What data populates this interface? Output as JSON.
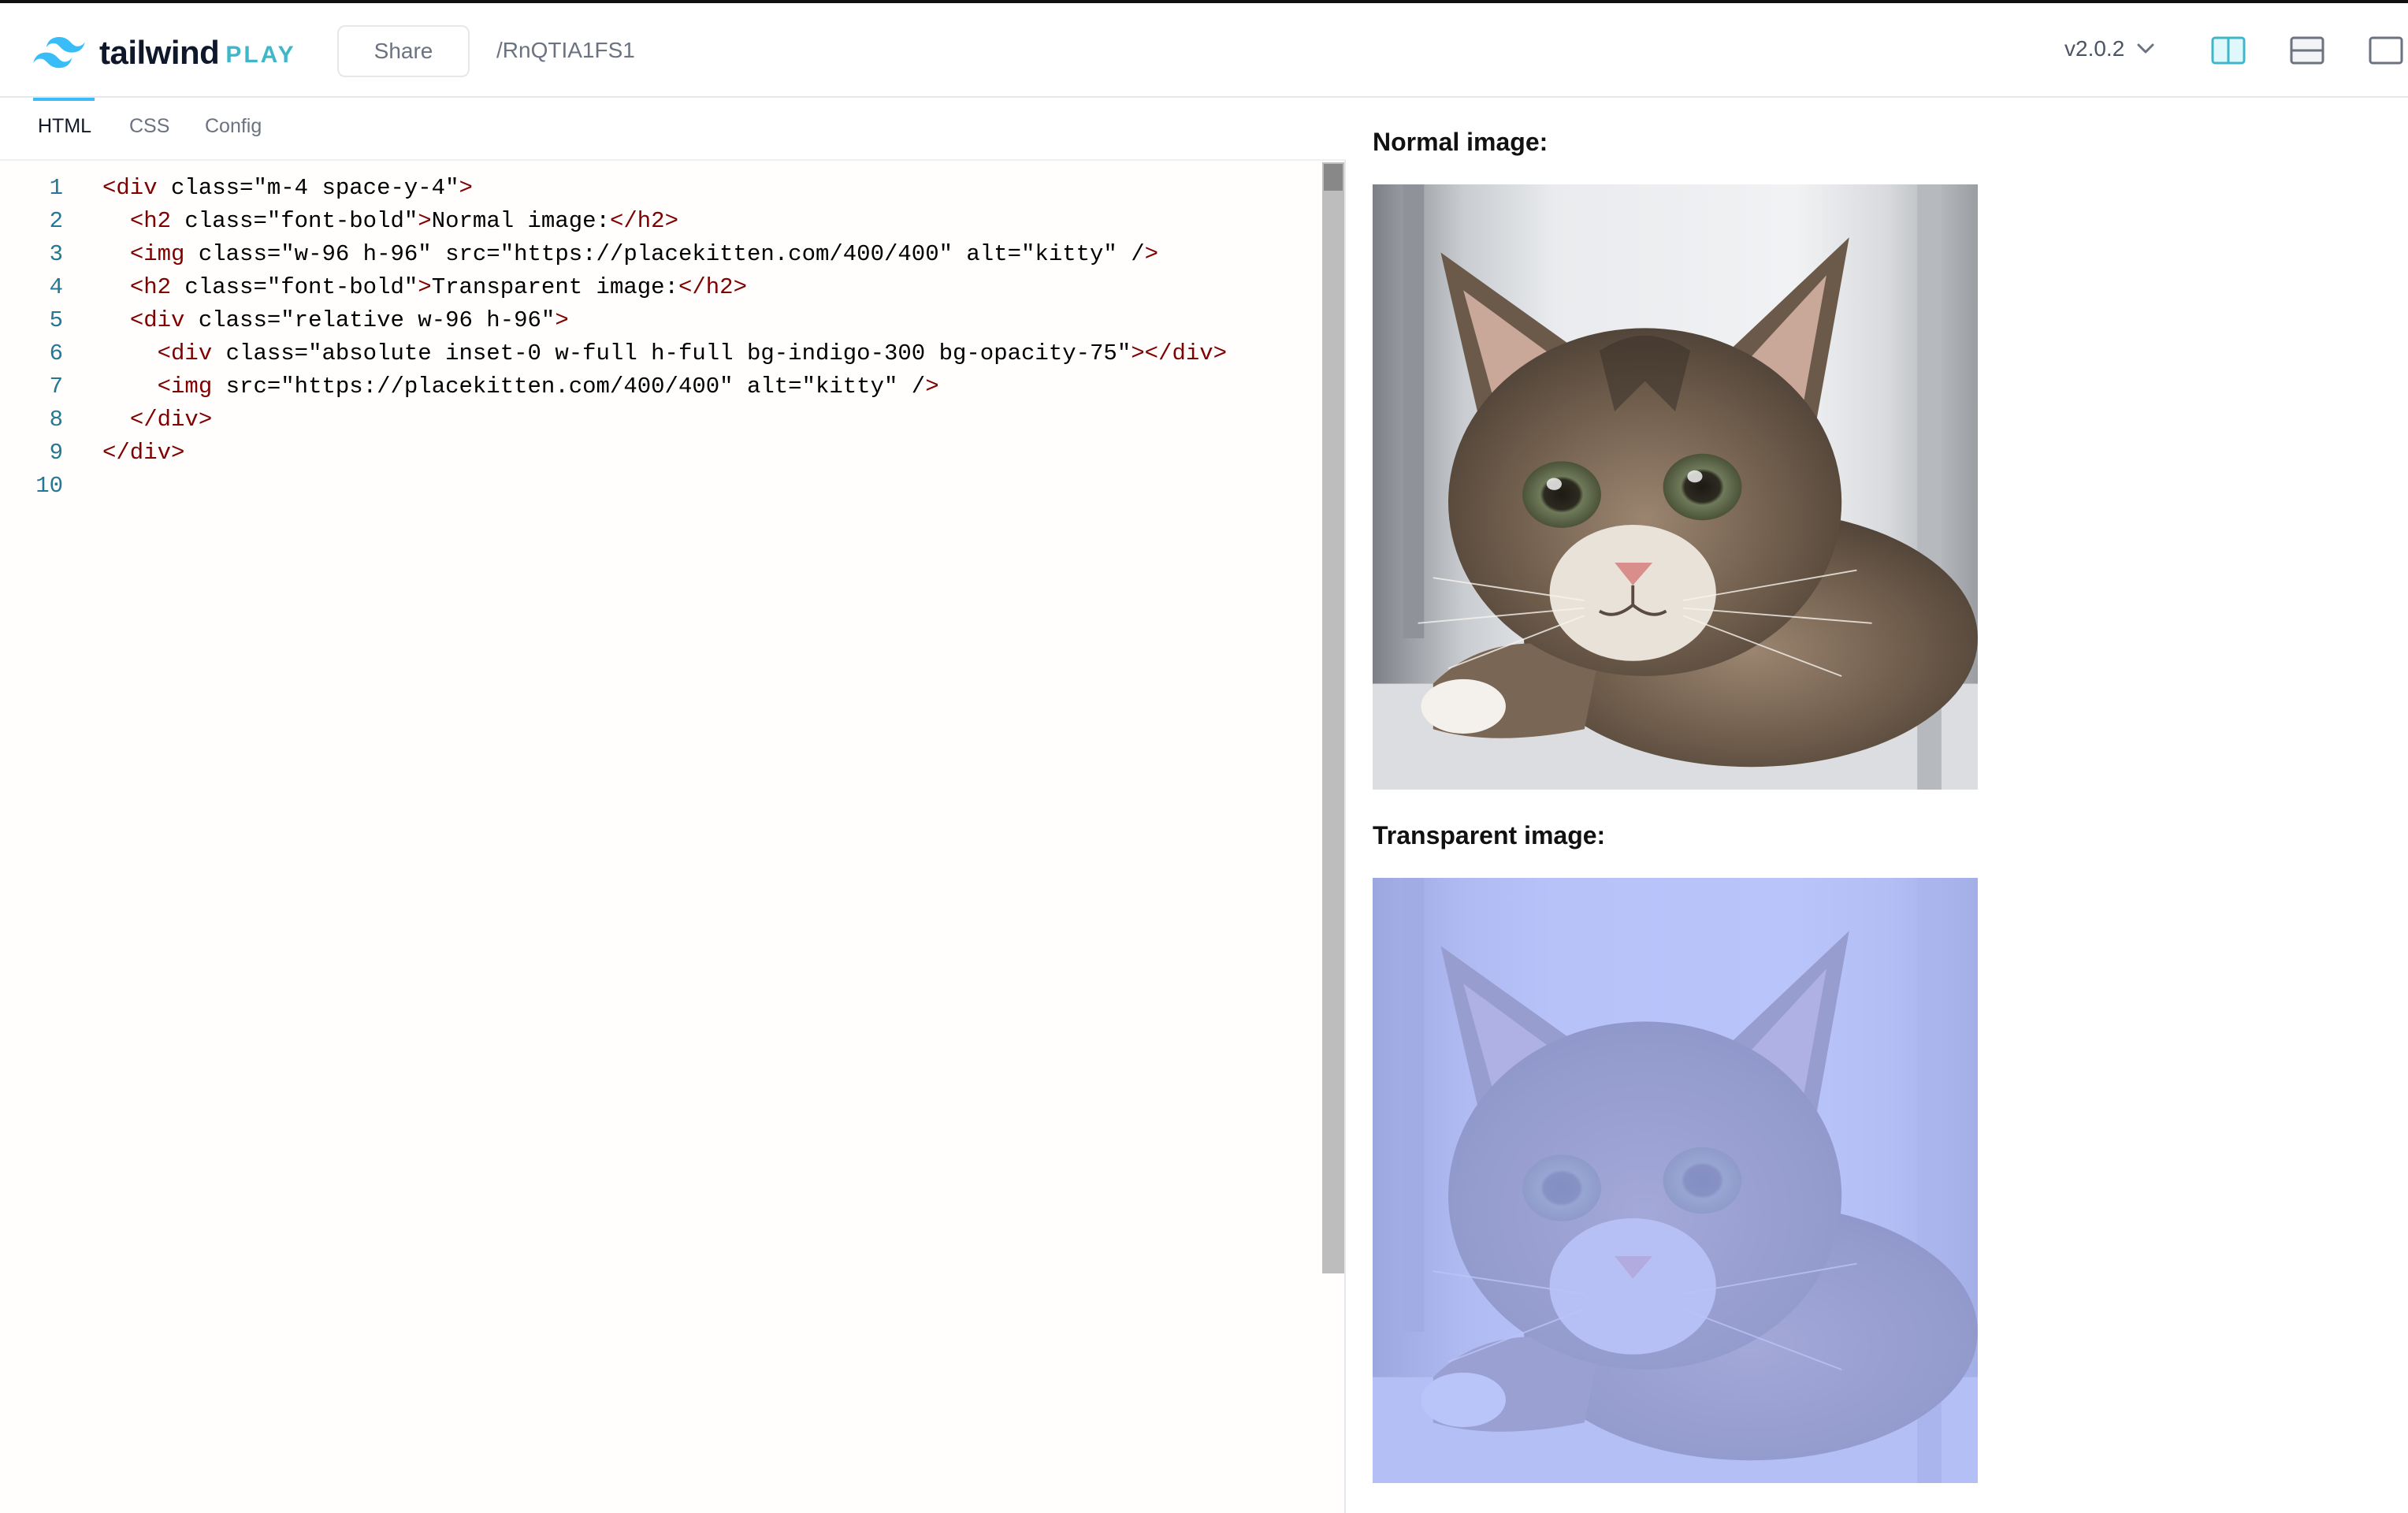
{
  "header": {
    "logo_text": "tailwind",
    "logo_play": "PLAY",
    "share_label": "Share",
    "url_path": "/RnQTIA1FS1",
    "version": "v2.0.2"
  },
  "tabs": [
    {
      "label": "HTML",
      "active": true
    },
    {
      "label": "CSS",
      "active": false
    },
    {
      "label": "Config",
      "active": false
    }
  ],
  "editor": {
    "line_numbers": [
      "1",
      "2",
      "3",
      "4",
      "5",
      "6",
      "7",
      "8",
      "9",
      "10"
    ],
    "lines": [
      "<div class=\"m-4 space-y-4\">",
      "  <h2 class=\"font-bold\">Normal image:</h2>",
      "  <img class=\"w-96 h-96\" src=\"https://placekitten.com/400/400\" alt=\"kitty\" />",
      "  <h2 class=\"font-bold\">Transparent image:</h2>",
      "  <div class=\"relative w-96 h-96\">",
      "    <div class=\"absolute inset-0 w-full h-full bg-indigo-300 bg-opacity-75\"></div>",
      "    <img src=\"https://placekitten.com/400/400\" alt=\"kitty\" />",
      "  </div>",
      "</div>",
      ""
    ]
  },
  "preview": {
    "heading_normal": "Normal image:",
    "heading_transparent": "Transparent image:",
    "image_alt": "kitty",
    "overlay_color": "#a5b4fc",
    "overlay_opacity": 0.75
  },
  "colors": {
    "accent": "#38bdf8",
    "tag": "#800000",
    "attribute": "#e50000",
    "value": "#0000ff",
    "line_number": "#237893"
  }
}
